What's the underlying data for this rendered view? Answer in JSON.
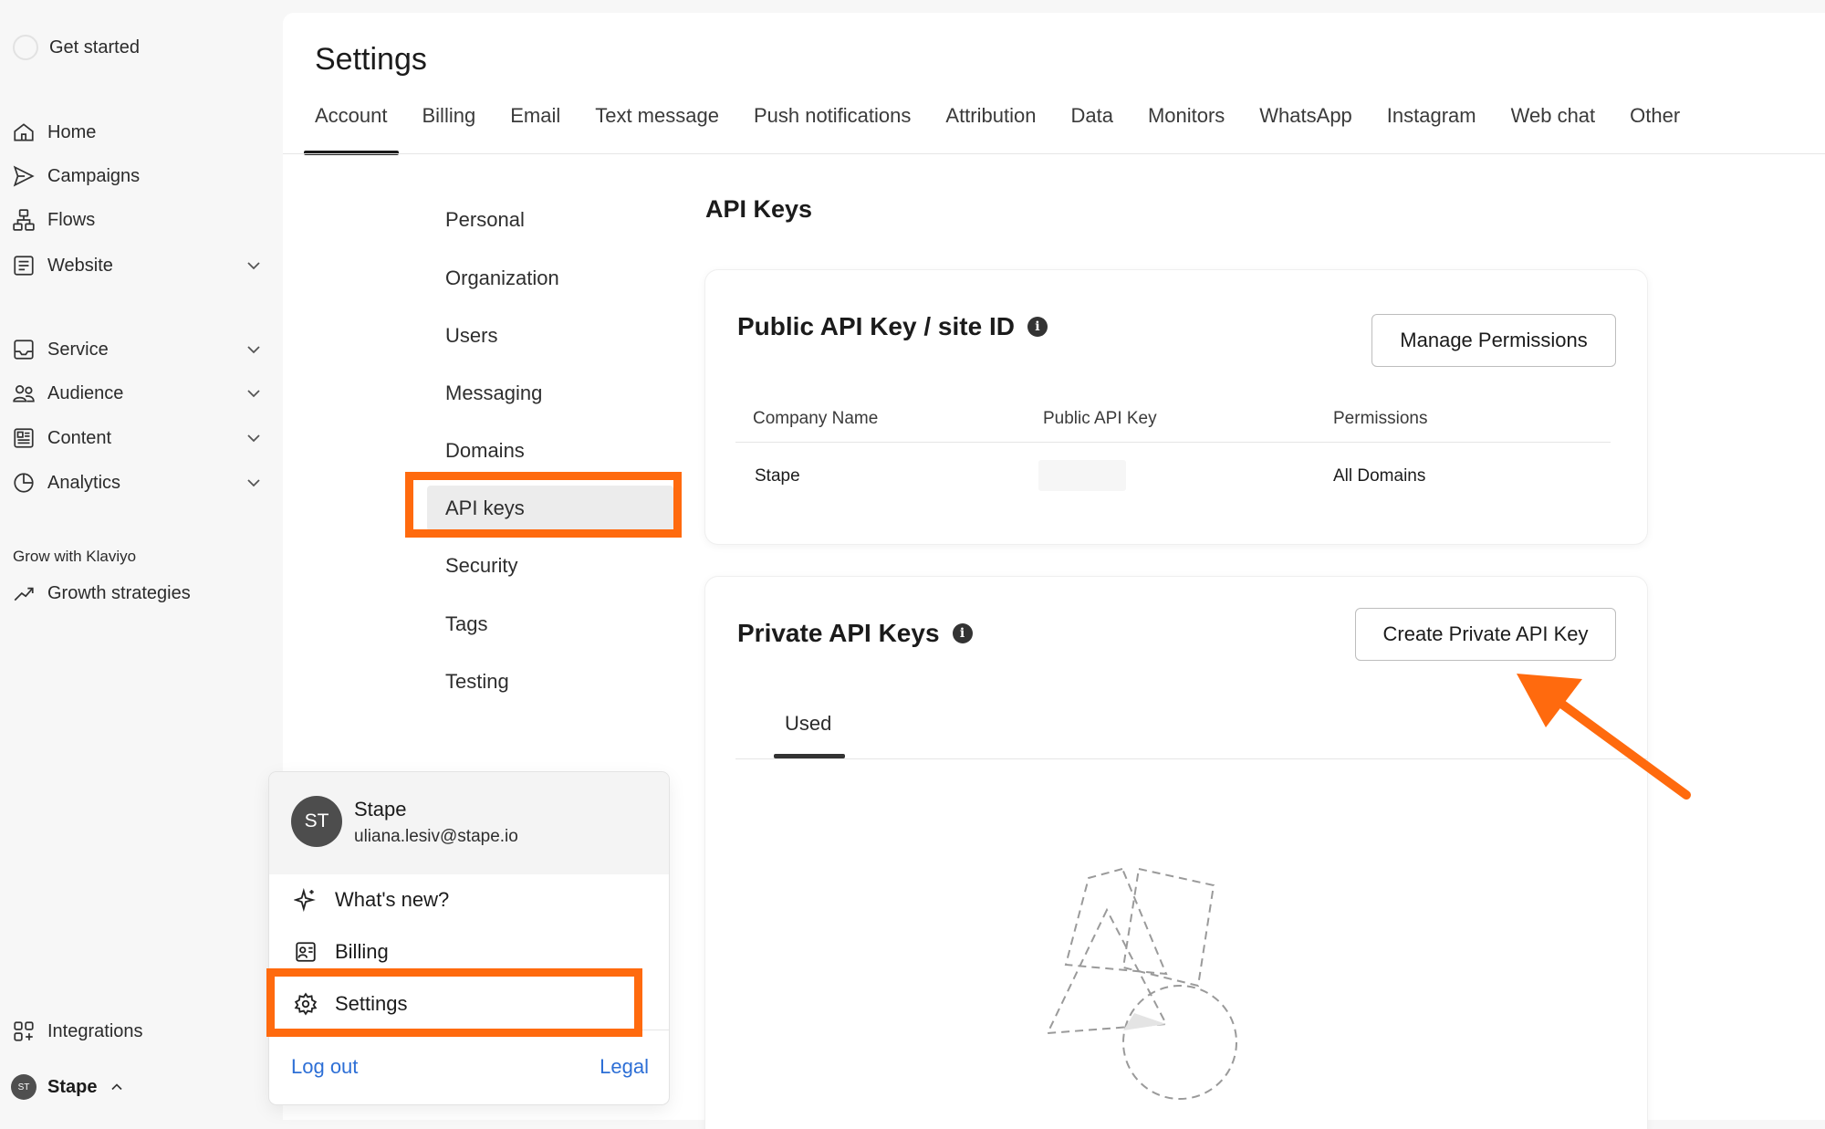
{
  "sidebar": {
    "get_started": "Get started",
    "items": [
      {
        "label": "Home",
        "icon": "home-icon"
      },
      {
        "label": "Campaigns",
        "icon": "send-icon"
      },
      {
        "label": "Flows",
        "icon": "flows-icon"
      },
      {
        "label": "Website",
        "icon": "website-icon"
      },
      {
        "label": "Service",
        "icon": "inbox-icon"
      },
      {
        "label": "Audience",
        "icon": "people-icon"
      },
      {
        "label": "Content",
        "icon": "content-icon"
      },
      {
        "label": "Analytics",
        "icon": "pie-chart-icon"
      }
    ],
    "grow_label": "Grow with Klaviyo",
    "growth": "Growth strategies",
    "integrations": "Integrations",
    "account_initials": "ST",
    "account_name": "Stape"
  },
  "header": {
    "title": "Settings",
    "tabs": [
      "Account",
      "Billing",
      "Email",
      "Text message",
      "Push notifications",
      "Attribution",
      "Data",
      "Monitors",
      "WhatsApp",
      "Instagram",
      "Web chat",
      "Other"
    ]
  },
  "subnav": [
    "Personal",
    "Organization",
    "Users",
    "Messaging",
    "Domains",
    "API keys",
    "Security",
    "Tags",
    "Testing"
  ],
  "content": {
    "section_title": "API Keys",
    "public_card": {
      "title": "Public API Key / site ID",
      "button": "Manage Permissions",
      "columns": [
        "Company Name",
        "Public API Key",
        "Permissions"
      ],
      "row": {
        "company": "Stape",
        "key": "",
        "permissions": "All Domains"
      }
    },
    "private_card": {
      "title": "Private API Keys",
      "button": "Create Private API Key",
      "tab": "Used"
    }
  },
  "popup": {
    "initials": "ST",
    "name": "Stape",
    "email": "uliana.lesiv@stape.io",
    "items": [
      "What's new?",
      "Billing",
      "Settings"
    ],
    "logout": "Log out",
    "legal": "Legal"
  },
  "colors": {
    "highlight": "#ff6a0e",
    "link": "#2d6fd6",
    "active_tab": "#1b1b1b"
  }
}
